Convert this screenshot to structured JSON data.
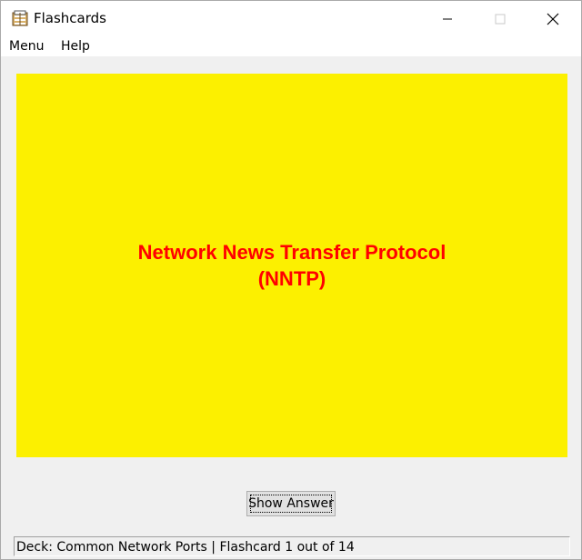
{
  "window": {
    "title": "Flashcards",
    "icon": "flashcards-app-icon"
  },
  "menubar": {
    "items": [
      {
        "label": "Menu"
      },
      {
        "label": "Help"
      }
    ]
  },
  "card": {
    "text": "Network News Transfer Protocol\n(NNTP)",
    "background_color": "#fcf000",
    "text_color": "#ff0000"
  },
  "actions": {
    "show_answer_label": "Show Answer"
  },
  "status": {
    "text": "Deck: Common Network Ports | Flashcard 1 out of 14"
  }
}
